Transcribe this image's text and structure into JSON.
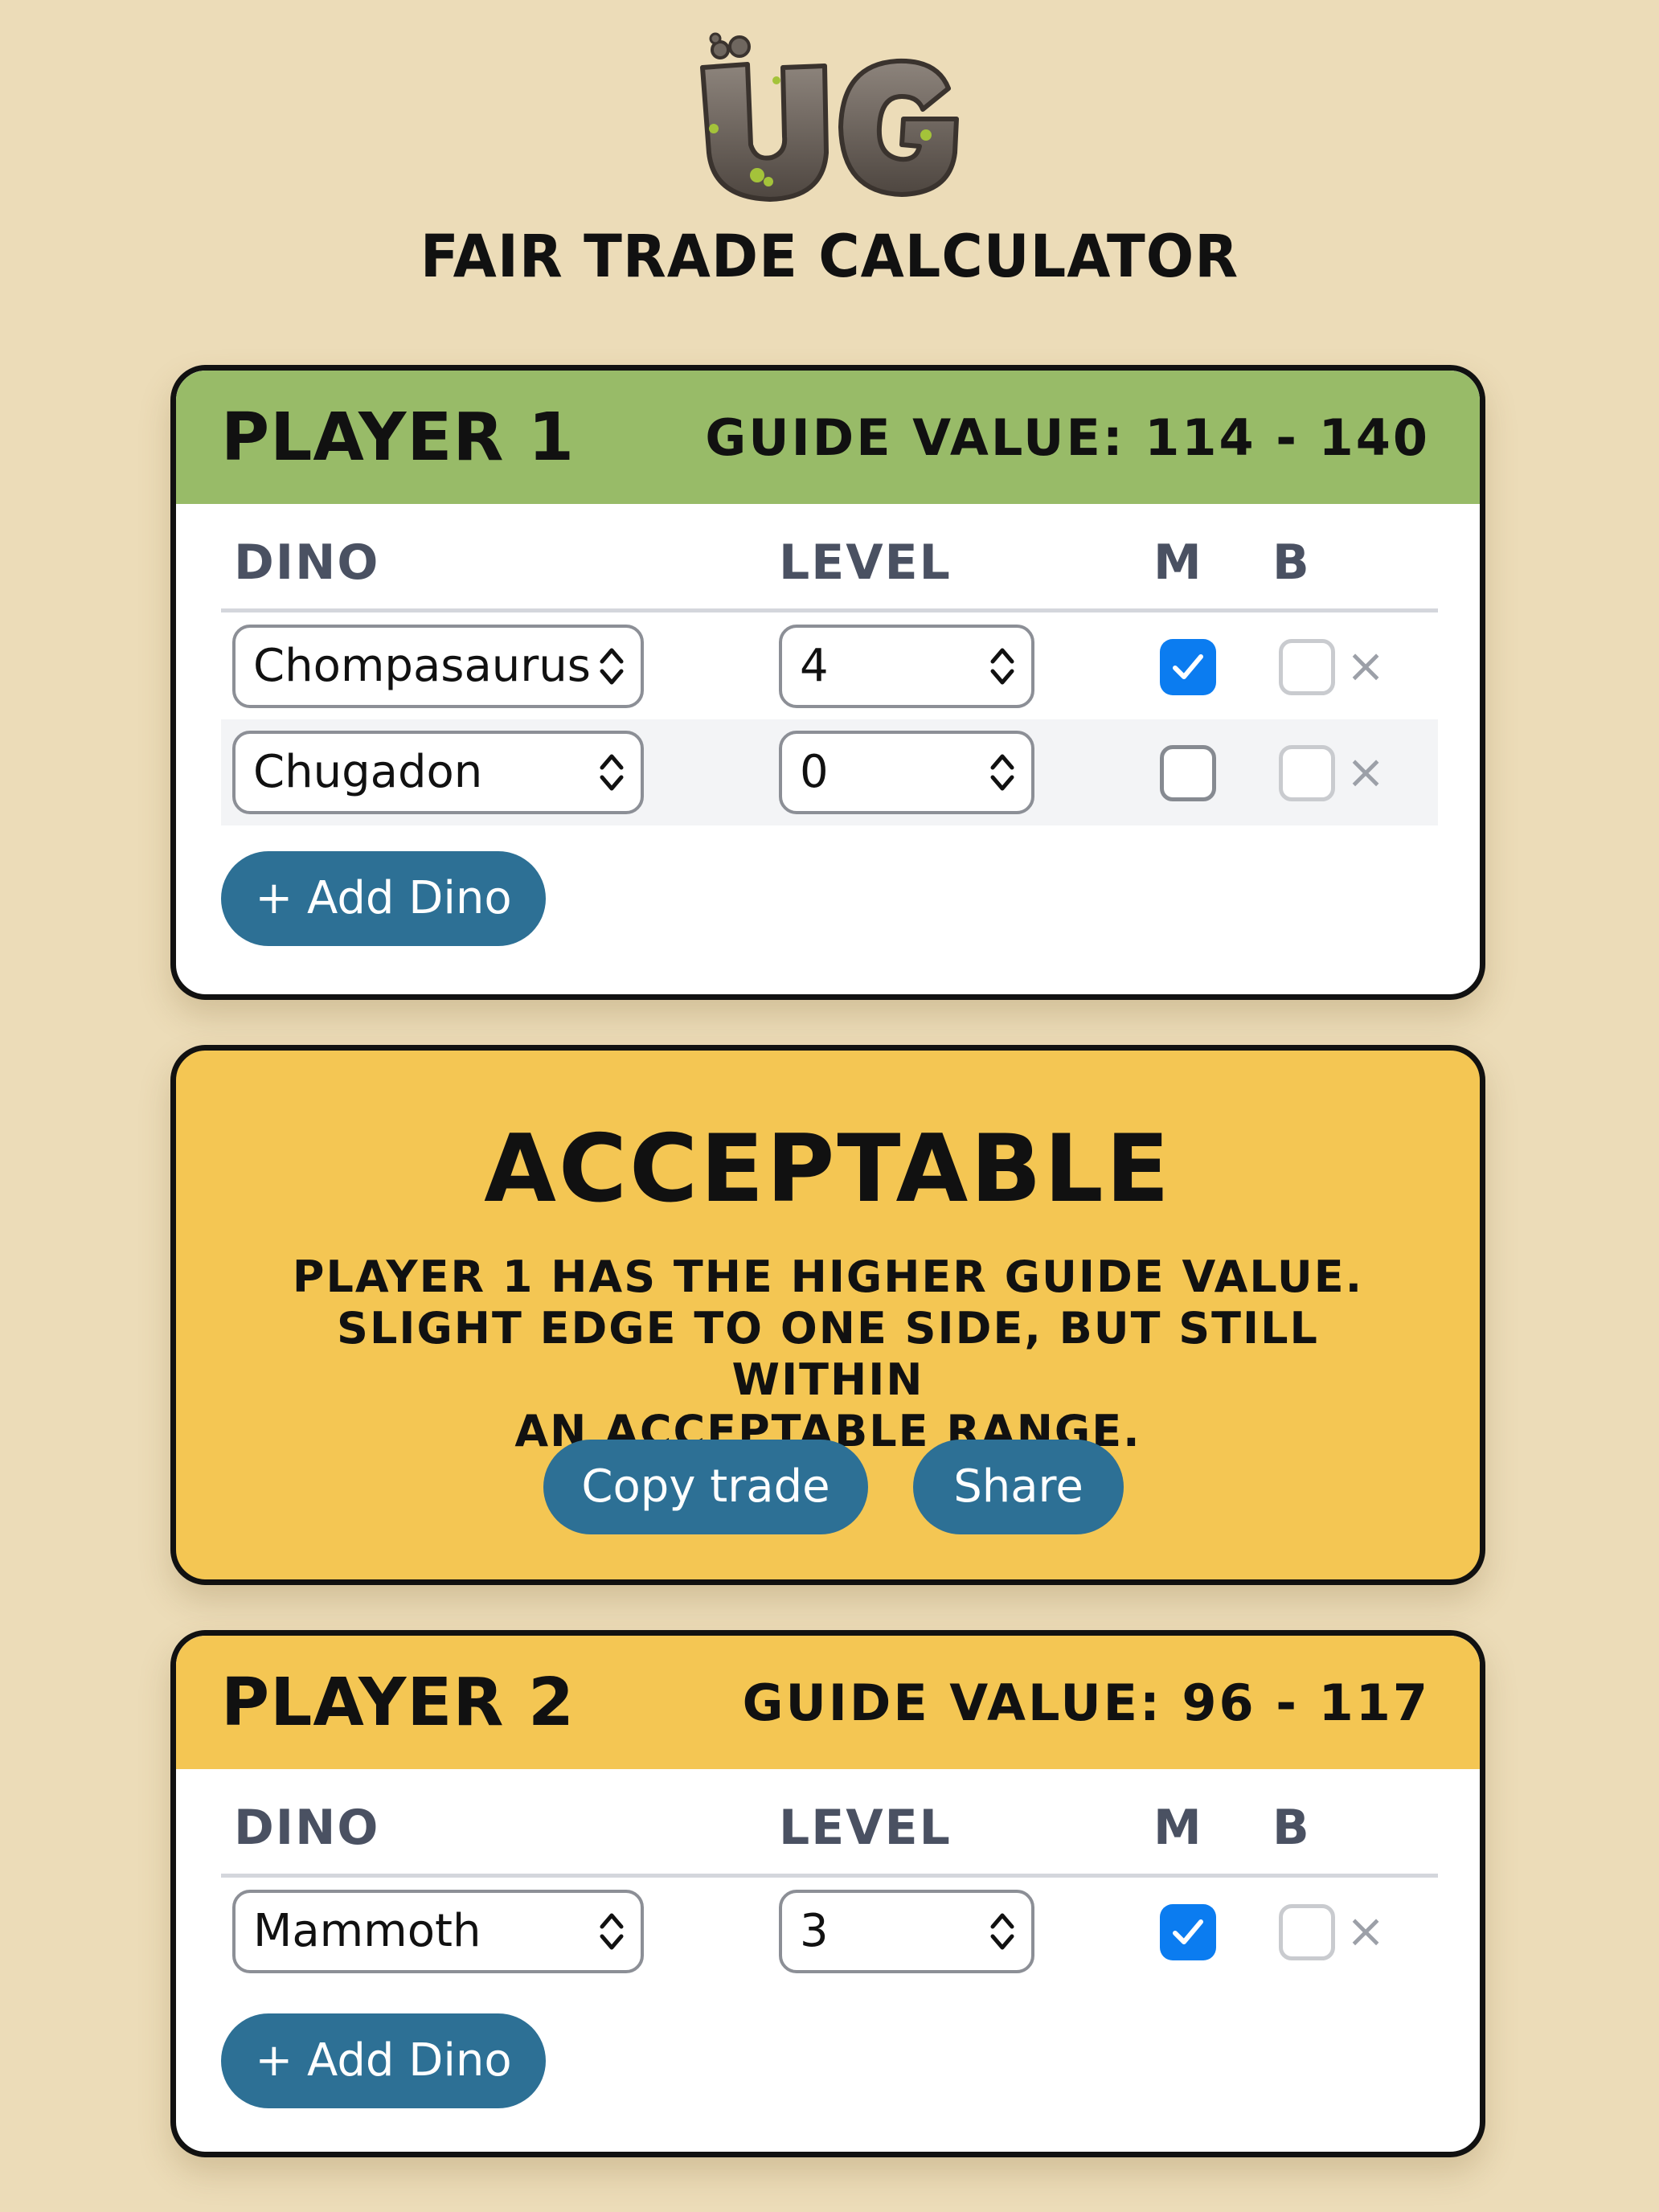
{
  "header": {
    "title": "Fair Trade Calculator"
  },
  "columns": {
    "dino": "Dino",
    "level": "Level",
    "m": "M",
    "b": "B"
  },
  "player1": {
    "name": "Player 1",
    "guide_value": "Guide value: 114 - 140",
    "rows": [
      {
        "dino": "Chompasaurus",
        "level": "4",
        "m": true,
        "b": false
      },
      {
        "dino": "Chugadon",
        "level": "0",
        "m": false,
        "b": false
      }
    ],
    "add_label": "+ Add Dino",
    "header_color": "#98bb68"
  },
  "player2": {
    "name": "Player 2",
    "guide_value": "Guide value: 96 - 117",
    "rows": [
      {
        "dino": "Mammoth",
        "level": "3",
        "m": true,
        "b": false
      }
    ],
    "add_label": "+ Add Dino",
    "header_color": "#f4c653"
  },
  "result": {
    "verdict": "Acceptable",
    "explanation_lines": [
      "Player 1 has the higher guide value.",
      "Slight edge to one side, but still within",
      "an acceptable range."
    ],
    "copy_label": "Copy trade",
    "share_label": "Share",
    "color": "#f4c653"
  },
  "icons": {
    "remove": "×",
    "logo": "stone-ug-logo-icon",
    "check": "check-icon",
    "chevron": "up-down-chevron-icon"
  },
  "colors": {
    "background": "#ecdcb8",
    "button": "#2d7095",
    "checkbox_on": "#0b7cf0"
  }
}
